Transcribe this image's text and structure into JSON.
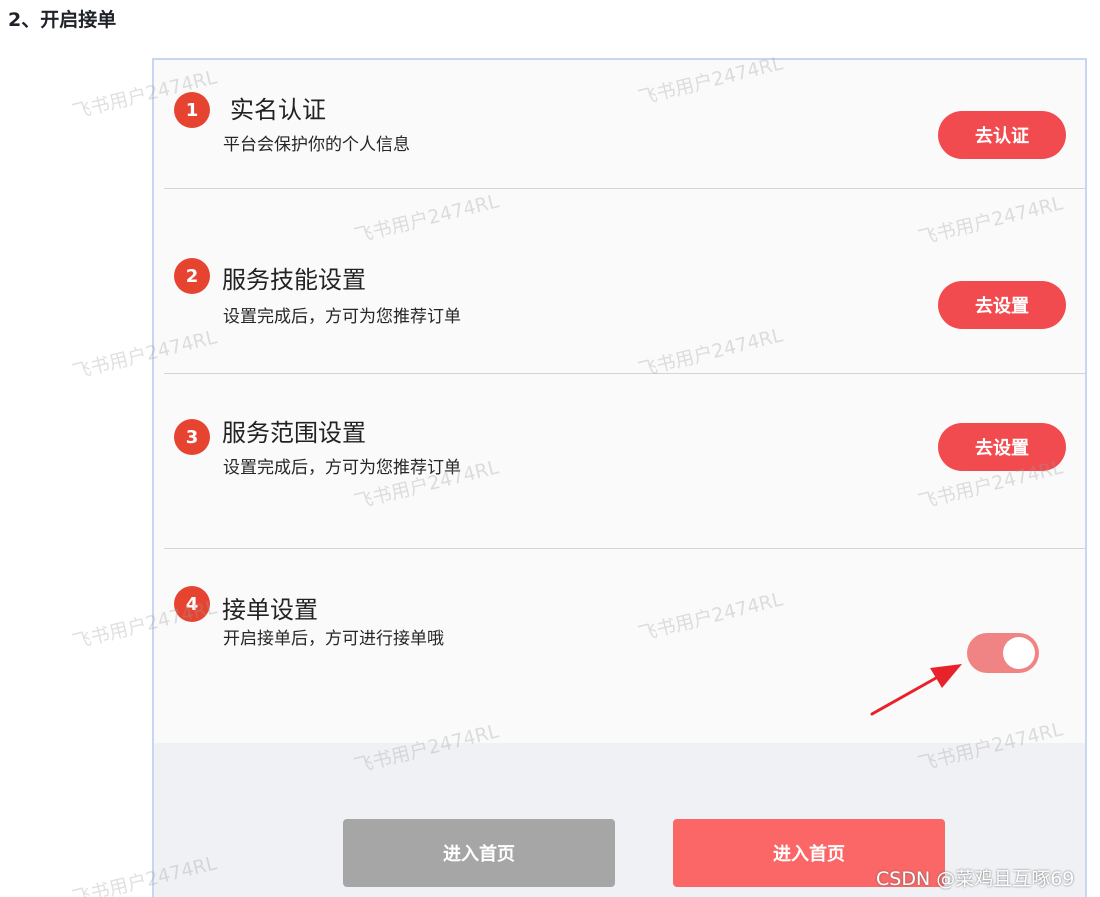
{
  "heading": "2、开启接单",
  "steps": [
    {
      "num": "1",
      "title": "实名认证",
      "desc": "平台会保护你的个人信息",
      "action": "去认证"
    },
    {
      "num": "2",
      "title": "服务技能设置",
      "desc": "设置完成后，方可为您推荐订单",
      "action": "去设置"
    },
    {
      "num": "3",
      "title": "服务范围设置",
      "desc": "设置完成后，方可为您推荐订单",
      "action": "去设置"
    },
    {
      "num": "4",
      "title": "接单设置",
      "desc": "开启接单后，方可进行接单哦",
      "toggle_on": true
    }
  ],
  "buttons": {
    "secondary": "进入首页",
    "primary": "进入首页"
  },
  "watermark": "飞书用户2474RL",
  "credit": "CSDN @菜鸡且互啄69",
  "colors": {
    "step_badge": "#e64431",
    "action_button": "#f24b4f",
    "toggle_track": "#f08484",
    "primary_button": "#fa6766",
    "secondary_button": "#a6a6a6",
    "arrow": "#e8222a"
  }
}
